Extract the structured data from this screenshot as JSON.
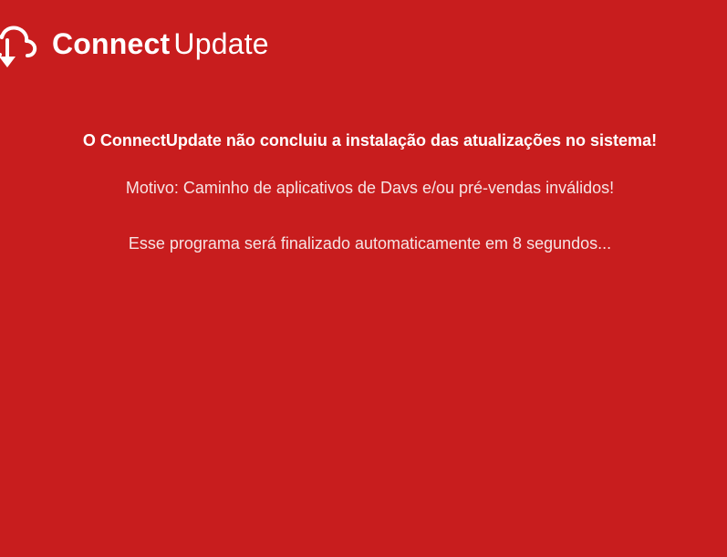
{
  "app": {
    "brand_bold": "Connect",
    "brand_light": "Update",
    "logo_icon": "cloud-download-icon"
  },
  "colors": {
    "background": "#c81d1e",
    "text": "#ffffff"
  },
  "messages": {
    "headline": "O ConnectUpdate não concluiu a instalação das atualizações no sistema!",
    "reason": "Motivo: Caminho de aplicativos de Davs e/ou pré-vendas inválidos!",
    "countdown": "Esse programa será finalizado automaticamente em 8 segundos..."
  }
}
